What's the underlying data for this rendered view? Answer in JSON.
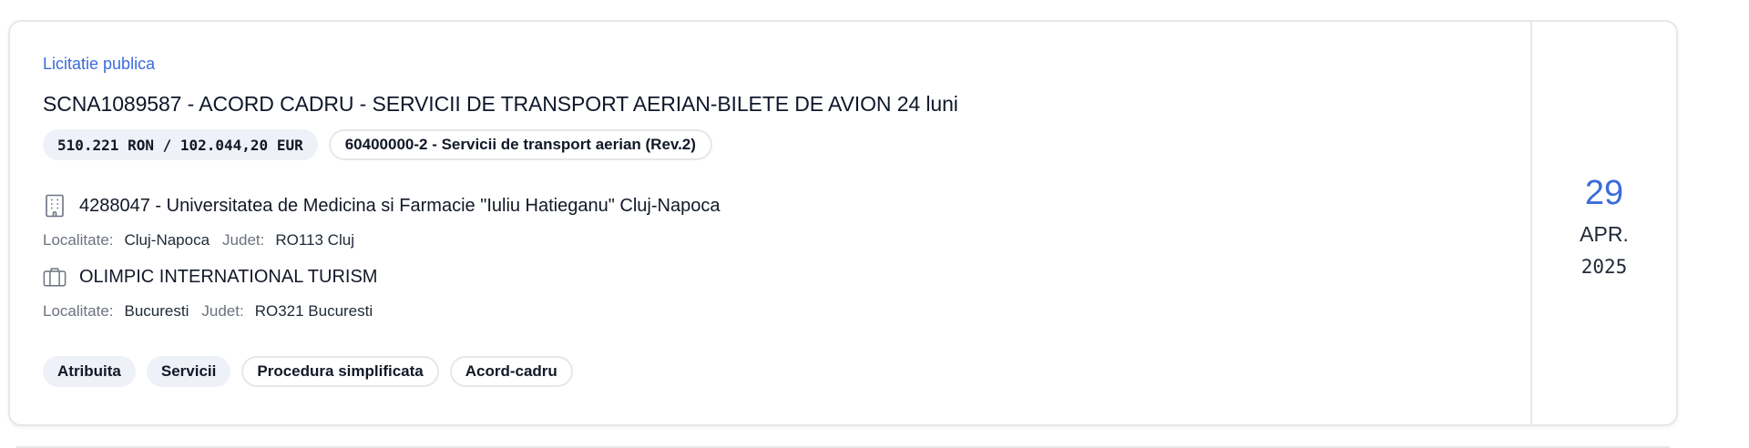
{
  "tender": {
    "type_label": "Licitatie publica",
    "title": "SCNA1089587 - ACORD CADRU - SERVICII DE TRANSPORT AERIAN-BILETE DE AVION 24 luni",
    "value": "510.221 RON / 102.044,20 EUR",
    "cpv": "60400000-2 - Servicii de transport aerian (Rev.2)"
  },
  "authority": {
    "icon": "building-icon",
    "name": "4288047 - Universitatea de Medicina si Farmacie \"Iuliu Hatieganu\" Cluj-Napoca",
    "localitate_label": "Localitate:",
    "localitate": "Cluj-Napoca",
    "judet_label": "Judet:",
    "judet": "RO113 Cluj"
  },
  "supplier": {
    "icon": "briefcase-icon",
    "name": "OLIMPIC INTERNATIONAL TURISM",
    "localitate_label": "Localitate:",
    "localitate": "Bucuresti",
    "judet_label": "Judet:",
    "judet": "RO321 Bucuresti"
  },
  "tags": {
    "status": "Atribuita",
    "category": "Servicii",
    "procedure": "Procedura simplificata",
    "contract_type": "Acord-cadru"
  },
  "date": {
    "day": "29",
    "month": "APR.",
    "year": "2025"
  },
  "colors": {
    "accent": "#3b6bdc",
    "chip_bg": "#eef1f7",
    "border": "#e5e7eb",
    "muted": "#6b7280"
  }
}
